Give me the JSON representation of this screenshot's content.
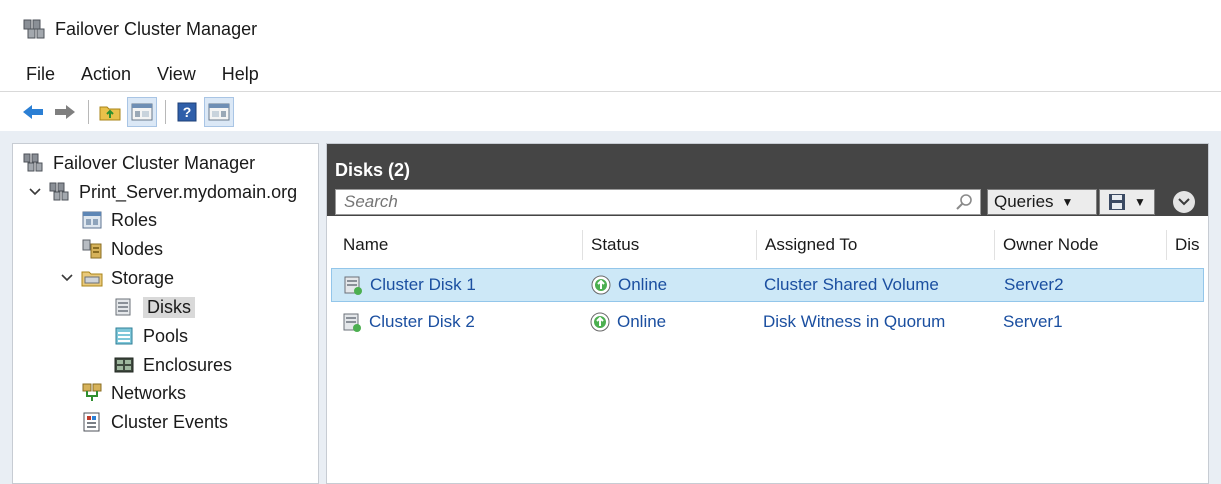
{
  "window": {
    "title": "Failover Cluster Manager",
    "icon": "cluster-manager-icon"
  },
  "menu": [
    "File",
    "Action",
    "View",
    "Help"
  ],
  "toolbar": {
    "buttons": [
      "back-arrow-icon",
      "forward-arrow-icon",
      "up-folder-icon",
      "show-hide-console-tree-icon",
      "help-icon",
      "show-hide-action-pane-icon"
    ]
  },
  "tree": {
    "root": "Failover Cluster Manager",
    "cluster": "Print_Server.mydomain.org",
    "roles": "Roles",
    "nodes": "Nodes",
    "storage": "Storage",
    "disks": "Disks",
    "pools": "Pools",
    "enclosures": "Enclosures",
    "networks": "Networks",
    "cluster_events": "Cluster Events"
  },
  "main": {
    "title": "Disks (2)",
    "search_placeholder": "Search",
    "queries_label": "Queries",
    "columns": [
      "Name",
      "Status",
      "Assigned To",
      "Owner Node",
      "Dis"
    ],
    "rows": [
      {
        "name": "Cluster Disk 1",
        "status": "Online",
        "assigned_to": "Cluster Shared Volume",
        "owner_node": "Server2",
        "selected": true
      },
      {
        "name": "Cluster Disk 2",
        "status": "Online",
        "assigned_to": "Disk Witness in Quorum",
        "owner_node": "Server1",
        "selected": false
      }
    ]
  },
  "colors": {
    "header_bg": "#454545",
    "selected_row": "#cde8f7",
    "link_text": "#1b4fa0",
    "online_green": "#4caf50"
  }
}
